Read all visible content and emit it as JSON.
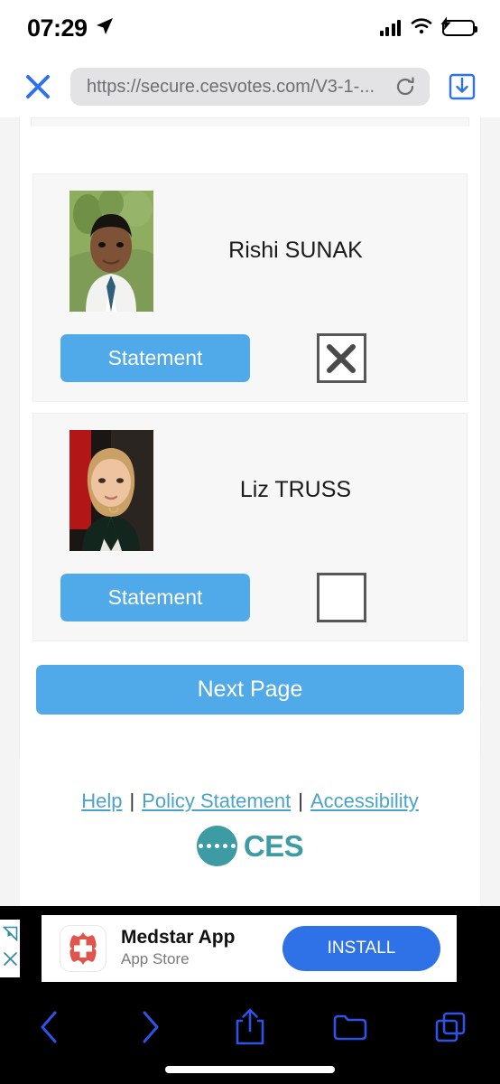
{
  "status_bar": {
    "time": "07:29",
    "location_icon": "location-arrow-icon",
    "signal_icon": "cellular-signal-icon",
    "wifi_icon": "wifi-icon",
    "battery_icon": "battery-charging-icon",
    "battery_color": "#37d04f"
  },
  "browser": {
    "close_icon": "close-x-icon",
    "url": "https://secure.cesvotes.com/V3-1-...",
    "reload_icon": "reload-icon",
    "download_icon": "download-icon",
    "accent_color": "#2f72e8"
  },
  "ballot": {
    "candidates": [
      {
        "name": "Rishi SUNAK",
        "statement_label": "Statement",
        "photo_alt": "rishi-sunak-photo",
        "selected": true,
        "mark": "✕"
      },
      {
        "name": "Liz TRUSS",
        "statement_label": "Statement",
        "photo_alt": "liz-truss-photo",
        "selected": false,
        "mark": ""
      }
    ],
    "next_page_label": "Next Page",
    "button_color": "#50a9e8",
    "checkbox_border_color": "#575757"
  },
  "footer": {
    "links": [
      {
        "label": "Help"
      },
      {
        "label": "Policy Statement"
      },
      {
        "label": "Accessibility"
      }
    ],
    "separator": "|",
    "logo_text": "CES",
    "logo_color": "#3d9ba4",
    "link_color": "#4ba3c7"
  },
  "ad": {
    "adchoices_icon": "adchoices-triangle-icon",
    "close_icon": "ad-close-icon",
    "app_icon": "medstar-cross-icon",
    "title": "Medstar App",
    "subtitle": "App Store",
    "install_label": "INSTALL",
    "install_color": "#2f72e8"
  },
  "toolbar": {
    "back_icon": "chevron-left-icon",
    "forward_icon": "chevron-right-icon",
    "share_icon": "share-icon",
    "bookmarks_icon": "folder-icon",
    "tabs_icon": "tabs-icon",
    "icon_color": "#2f52e8"
  }
}
